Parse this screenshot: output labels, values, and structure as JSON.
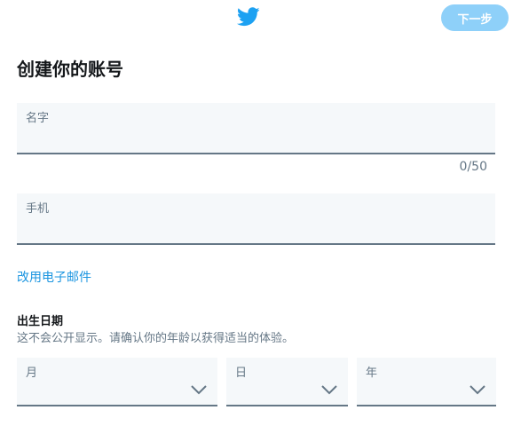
{
  "header": {
    "logo_icon": "twitter-bird-icon",
    "next_label": "下一步",
    "brand_color": "#1da1f2",
    "next_button_color": "#8ed0f9"
  },
  "form": {
    "title": "创建你的账号",
    "name": {
      "label": "名字",
      "value": "",
      "counter": "0/50"
    },
    "phone": {
      "label": "手机",
      "value": ""
    },
    "switch_link": "改用电子邮件"
  },
  "dob": {
    "title": "出生日期",
    "description": "这不会公开显示。请确认你的年龄以获得适当的体验。",
    "month_label": "月",
    "day_label": "日",
    "year_label": "年",
    "chevron_icon": "chevron-down-icon"
  },
  "colors": {
    "field_background": "#f5f8fa",
    "field_border": "#657786",
    "link": "#1b95e0"
  }
}
